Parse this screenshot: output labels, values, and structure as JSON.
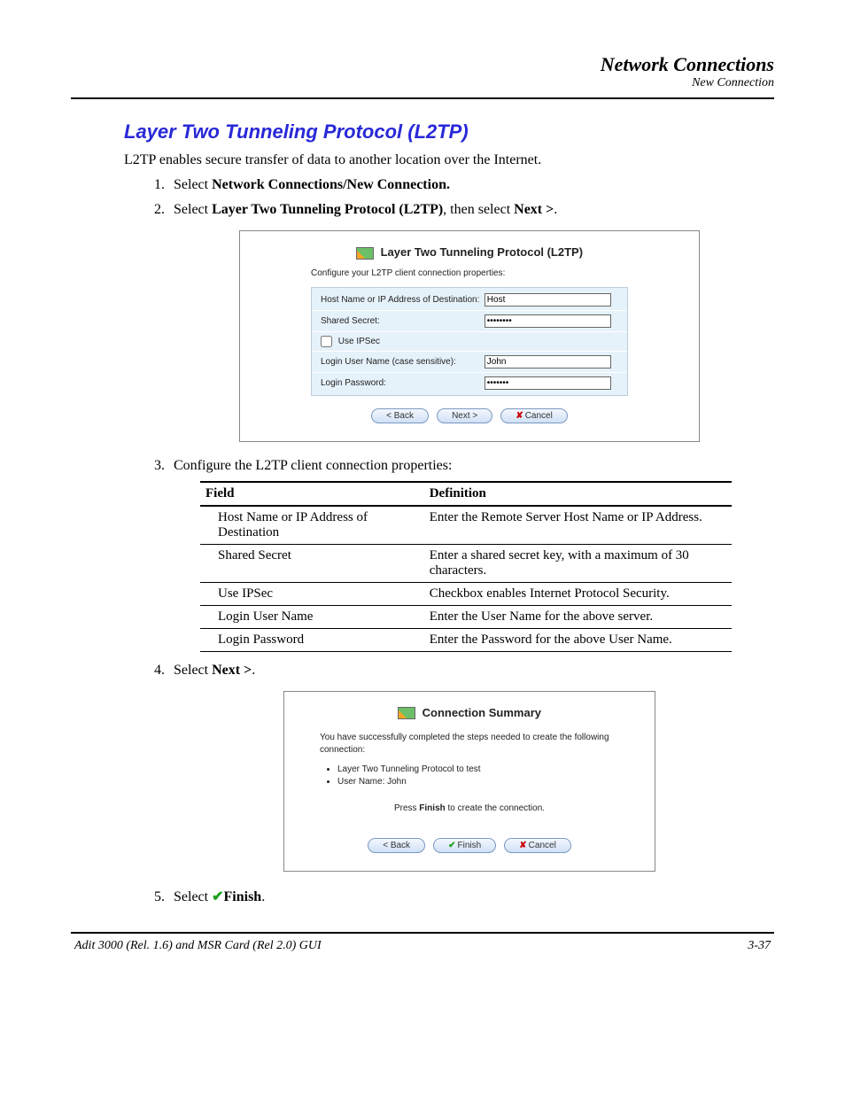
{
  "header": {
    "title": "Network Connections",
    "subtitle": "New Connection"
  },
  "section": {
    "title": "Layer Two Tunneling Protocol (L2TP)",
    "intro": "L2TP enables secure transfer of data to another location over the Internet.",
    "step1_prefix": "Select ",
    "step1_bold": "Network Connections/New Connection.",
    "step2_prefix": "Select ",
    "step2_bold": "Layer Two Tunneling Protocol (L2TP)",
    "step2_suffix": ", then select ",
    "step2_bold2": "Next >",
    "step2_end": ".",
    "step3": "Configure the L2TP client connection properties:",
    "step4_prefix": "Select ",
    "step4_bold": "Next >",
    "step4_end": ".",
    "step5_prefix": "Select ",
    "step5_bold": "Finish",
    "step5_end": "."
  },
  "dialog1": {
    "title": "Layer Two Tunneling Protocol (L2TP)",
    "subtext": "Configure your L2TP client connection properties:",
    "rows": {
      "host_label": "Host Name or IP Address of Destination:",
      "host_value": "Host",
      "secret_label": "Shared Secret:",
      "secret_value": "••••••••",
      "ipsec_label": "Use IPSec",
      "user_label": "Login User Name (case sensitive):",
      "user_value": "John",
      "pass_label": "Login Password:",
      "pass_value": "•••••••"
    },
    "buttons": {
      "back": "< Back",
      "next": "Next >",
      "cancel": "Cancel"
    }
  },
  "def_table": {
    "head_field": "Field",
    "head_def": "Definition",
    "rows": [
      {
        "field": "Host Name or IP Address of Destination",
        "def": "Enter the Remote Server Host Name or IP Address."
      },
      {
        "field": "Shared Secret",
        "def": "Enter a shared secret key, with a maximum of 30 characters."
      },
      {
        "field": "Use IPSec",
        "def": "Checkbox enables Internet Protocol Security."
      },
      {
        "field": "Login User Name",
        "def": "Enter the User Name for the above server."
      },
      {
        "field": "Login Password",
        "def": "Enter the Password for the above User Name."
      }
    ]
  },
  "dialog2": {
    "title": "Connection Summary",
    "intro": "You have successfully completed the steps needed to create the following connection:",
    "bullets": [
      "Layer Two Tunneling Protocol to test",
      "User Name: John"
    ],
    "press_prefix": "Press ",
    "press_bold": "Finish",
    "press_suffix": " to create the connection.",
    "buttons": {
      "back": "< Back",
      "finish": "Finish",
      "cancel": "Cancel"
    }
  },
  "footer": {
    "left": "Adit 3000 (Rel. 1.6) and MSR Card (Rel 2.0) GUI",
    "right": "3-37"
  }
}
